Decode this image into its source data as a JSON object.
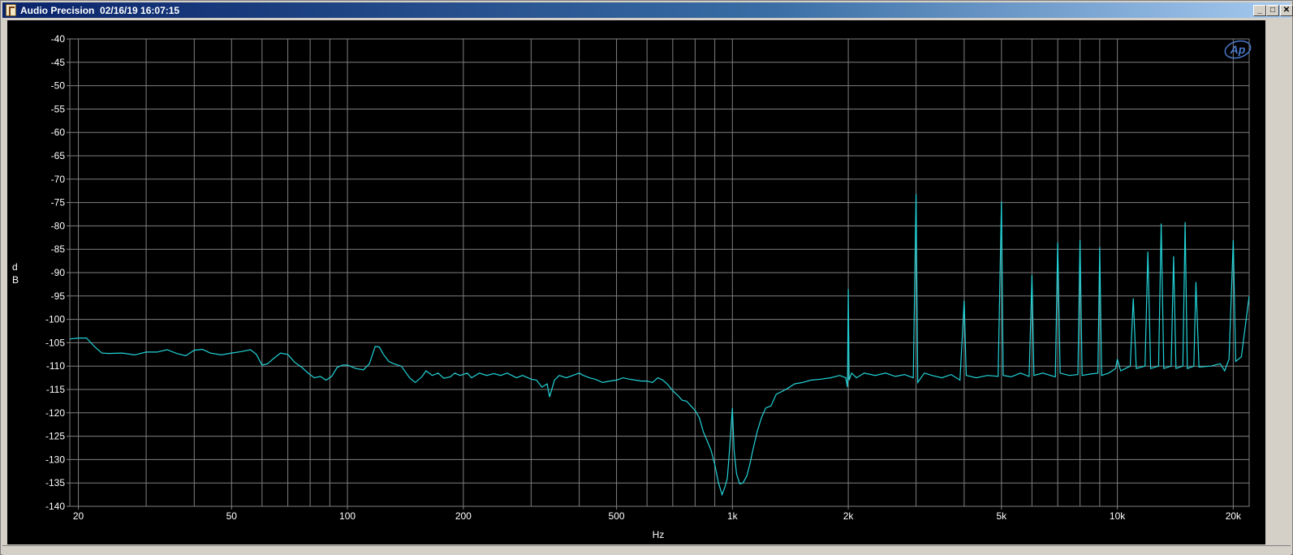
{
  "window": {
    "title": "Audio Precision  02/16/19 16:07:15",
    "minimize_glyph": "_",
    "maximize_glyph": "□",
    "close_glyph": "✕"
  },
  "logo_text": "Ap",
  "colors": {
    "plot_bg": "#000000",
    "grid": "#808080",
    "trace": "#22d3d8",
    "axis_text": "#ffffff",
    "logo": "#4a78c8"
  },
  "chart_data": {
    "type": "line",
    "xlabel": "Hz",
    "ylabel": "dB",
    "x_scale": "log",
    "xlim": [
      19,
      22000
    ],
    "ylim": [
      -140,
      -40
    ],
    "grid": true,
    "y_ticks": [
      -40,
      -45,
      -50,
      -55,
      -60,
      -65,
      -70,
      -75,
      -80,
      -85,
      -90,
      -95,
      -100,
      -105,
      -110,
      -115,
      -120,
      -125,
      -130,
      -135,
      -140
    ],
    "x_ticks": [
      {
        "value": 20,
        "label": "20"
      },
      {
        "value": 50,
        "label": "50"
      },
      {
        "value": 100,
        "label": "100"
      },
      {
        "value": 200,
        "label": "200"
      },
      {
        "value": 500,
        "label": "500"
      },
      {
        "value": 1000,
        "label": "1k"
      },
      {
        "value": 2000,
        "label": "2k"
      },
      {
        "value": 5000,
        "label": "5k"
      },
      {
        "value": 10000,
        "label": "10k"
      },
      {
        "value": 20000,
        "label": "20k"
      }
    ],
    "x_minor_grid": [
      30,
      40,
      60,
      70,
      80,
      90,
      300,
      400,
      600,
      700,
      800,
      900,
      3000,
      4000,
      6000,
      7000,
      8000,
      9000
    ],
    "series": [
      {
        "points": [
          [
            19,
            -104.2
          ],
          [
            20,
            -104
          ],
          [
            21,
            -104
          ],
          [
            22,
            -105.8
          ],
          [
            23,
            -107.2
          ],
          [
            24,
            -107.3
          ],
          [
            26,
            -107.2
          ],
          [
            28,
            -107.6
          ],
          [
            30,
            -107
          ],
          [
            32,
            -107
          ],
          [
            34,
            -106.5
          ],
          [
            36,
            -107.3
          ],
          [
            38,
            -107.8
          ],
          [
            40,
            -106.6
          ],
          [
            42,
            -106.4
          ],
          [
            44,
            -107.2
          ],
          [
            47,
            -107.6
          ],
          [
            50,
            -107.2
          ],
          [
            53,
            -106.9
          ],
          [
            56,
            -106.5
          ],
          [
            58,
            -107.5
          ],
          [
            60,
            -109.8
          ],
          [
            62,
            -109.5
          ],
          [
            64,
            -108.5
          ],
          [
            67,
            -107.2
          ],
          [
            70,
            -107.5
          ],
          [
            73,
            -109.2
          ],
          [
            76,
            -110.2
          ],
          [
            79,
            -111.5
          ],
          [
            82,
            -112.5
          ],
          [
            85,
            -112.2
          ],
          [
            88,
            -113
          ],
          [
            91,
            -112.2
          ],
          [
            94,
            -110.3
          ],
          [
            97,
            -109.8
          ],
          [
            100,
            -109.8
          ],
          [
            105,
            -110.5
          ],
          [
            110,
            -110.8
          ],
          [
            114,
            -109.5
          ],
          [
            118,
            -105.8
          ],
          [
            121,
            -105.9
          ],
          [
            124,
            -107.5
          ],
          [
            128,
            -109
          ],
          [
            132,
            -109.5
          ],
          [
            138,
            -110
          ],
          [
            145,
            -112.5
          ],
          [
            150,
            -113.5
          ],
          [
            156,
            -112.3
          ],
          [
            160,
            -111
          ],
          [
            166,
            -112
          ],
          [
            172,
            -111.5
          ],
          [
            178,
            -112.6
          ],
          [
            185,
            -112.3
          ],
          [
            190,
            -111.5
          ],
          [
            196,
            -112
          ],
          [
            205,
            -111.5
          ],
          [
            210,
            -112.5
          ],
          [
            220,
            -111.5
          ],
          [
            230,
            -112
          ],
          [
            240,
            -111.6
          ],
          [
            250,
            -112
          ],
          [
            260,
            -111.5
          ],
          [
            275,
            -112.5
          ],
          [
            285,
            -112
          ],
          [
            300,
            -112.8
          ],
          [
            310,
            -113
          ],
          [
            320,
            -114.5
          ],
          [
            330,
            -113.8
          ],
          [
            335,
            -116.6
          ],
          [
            345,
            -113
          ],
          [
            355,
            -112
          ],
          [
            370,
            -112.5
          ],
          [
            385,
            -112
          ],
          [
            400,
            -111.5
          ],
          [
            410,
            -112
          ],
          [
            425,
            -112.5
          ],
          [
            440,
            -112.8
          ],
          [
            460,
            -113.5
          ],
          [
            480,
            -113.2
          ],
          [
            500,
            -113
          ],
          [
            520,
            -112.5
          ],
          [
            540,
            -112.8
          ],
          [
            560,
            -113
          ],
          [
            580,
            -113.2
          ],
          [
            600,
            -113.2
          ],
          [
            620,
            -113.5
          ],
          [
            640,
            -112.5
          ],
          [
            660,
            -113
          ],
          [
            680,
            -114
          ],
          [
            700,
            -115.3
          ],
          [
            720,
            -116.2
          ],
          [
            740,
            -117.3
          ],
          [
            760,
            -117.5
          ],
          [
            780,
            -118.5
          ],
          [
            800,
            -119.5
          ],
          [
            820,
            -121
          ],
          [
            840,
            -124
          ],
          [
            860,
            -126
          ],
          [
            880,
            -128
          ],
          [
            900,
            -131
          ],
          [
            920,
            -135
          ],
          [
            940,
            -137.5
          ],
          [
            955,
            -136
          ],
          [
            970,
            -134
          ],
          [
            985,
            -127
          ],
          [
            1000,
            -119
          ],
          [
            1010,
            -128
          ],
          [
            1025,
            -133
          ],
          [
            1045,
            -135.2
          ],
          [
            1065,
            -135
          ],
          [
            1090,
            -133.5
          ],
          [
            1110,
            -131
          ],
          [
            1130,
            -128
          ],
          [
            1160,
            -124
          ],
          [
            1190,
            -121
          ],
          [
            1220,
            -119
          ],
          [
            1260,
            -118.5
          ],
          [
            1300,
            -116
          ],
          [
            1340,
            -115.5
          ],
          [
            1390,
            -114.8
          ],
          [
            1450,
            -113.8
          ],
          [
            1520,
            -113.5
          ],
          [
            1600,
            -113
          ],
          [
            1700,
            -112.8
          ],
          [
            1800,
            -112.5
          ],
          [
            1900,
            -112
          ],
          [
            1970,
            -112.5
          ],
          [
            1990,
            -114.5
          ],
          [
            2000,
            -93.5
          ],
          [
            2010,
            -113
          ],
          [
            2040,
            -111.5
          ],
          [
            2100,
            -112.5
          ],
          [
            2200,
            -111.5
          ],
          [
            2350,
            -112
          ],
          [
            2500,
            -111.5
          ],
          [
            2650,
            -112.2
          ],
          [
            2800,
            -111.8
          ],
          [
            2950,
            -112.5
          ],
          [
            3000,
            -73.2
          ],
          [
            3030,
            -113.5
          ],
          [
            3150,
            -111.5
          ],
          [
            3300,
            -112
          ],
          [
            3500,
            -112.5
          ],
          [
            3700,
            -111.8
          ],
          [
            3900,
            -113
          ],
          [
            4000,
            -96
          ],
          [
            4050,
            -112
          ],
          [
            4300,
            -112.5
          ],
          [
            4600,
            -112
          ],
          [
            4900,
            -112.2
          ],
          [
            5000,
            -74.8
          ],
          [
            5050,
            -112
          ],
          [
            5300,
            -112.3
          ],
          [
            5600,
            -111.5
          ],
          [
            5900,
            -112.2
          ],
          [
            6000,
            -90.5
          ],
          [
            6070,
            -112
          ],
          [
            6400,
            -111.5
          ],
          [
            6900,
            -112.3
          ],
          [
            7000,
            -83.5
          ],
          [
            7100,
            -111.5
          ],
          [
            7500,
            -112
          ],
          [
            7900,
            -111.8
          ],
          [
            8000,
            -83
          ],
          [
            8100,
            -112
          ],
          [
            8500,
            -111.7
          ],
          [
            8900,
            -111.5
          ],
          [
            9000,
            -84.5
          ],
          [
            9100,
            -112
          ],
          [
            9500,
            -111.5
          ],
          [
            9900,
            -110.5
          ],
          [
            10000,
            -108.5
          ],
          [
            10200,
            -111
          ],
          [
            10800,
            -110
          ],
          [
            11000,
            -95.5
          ],
          [
            11200,
            -110.5
          ],
          [
            11800,
            -110
          ],
          [
            12000,
            -85.5
          ],
          [
            12200,
            -110.5
          ],
          [
            12800,
            -110
          ],
          [
            13000,
            -79.5
          ],
          [
            13200,
            -110.5
          ],
          [
            13800,
            -110
          ],
          [
            14000,
            -86.5
          ],
          [
            14200,
            -110.5
          ],
          [
            14800,
            -110
          ],
          [
            15000,
            -79.2
          ],
          [
            15200,
            -110.5
          ],
          [
            15800,
            -110
          ],
          [
            16000,
            -92
          ],
          [
            16300,
            -110.2
          ],
          [
            17500,
            -110
          ],
          [
            18500,
            -109.5
          ],
          [
            19000,
            -111
          ],
          [
            19500,
            -108.5
          ],
          [
            20000,
            -83
          ],
          [
            20300,
            -109
          ],
          [
            21000,
            -108
          ],
          [
            22000,
            -95
          ]
        ]
      }
    ]
  }
}
